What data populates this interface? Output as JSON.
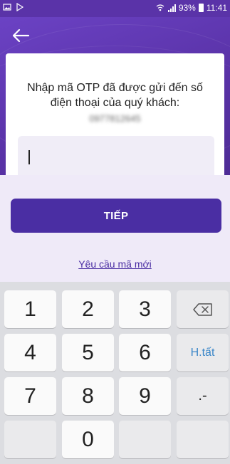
{
  "status_bar": {
    "battery": "93%",
    "time": "11:41"
  },
  "screen": {
    "title_line1": "Nhập mã OTP đã được gửi đến số",
    "title_line2": "điện thoại của quý khách:",
    "masked_phone": "0977812645",
    "otp_value": "",
    "next_label": "TIẾP",
    "resend_label": "Yêu cầu mã mới"
  },
  "keyboard": {
    "keys": [
      "1",
      "2",
      "3",
      "4",
      "5",
      "6",
      "7",
      "8",
      "9",
      "0"
    ],
    "done_label": "H.tất",
    "dot_dash_label": ".-"
  },
  "colors": {
    "primary": "#4a2ea3",
    "header": "#5a33a8"
  }
}
